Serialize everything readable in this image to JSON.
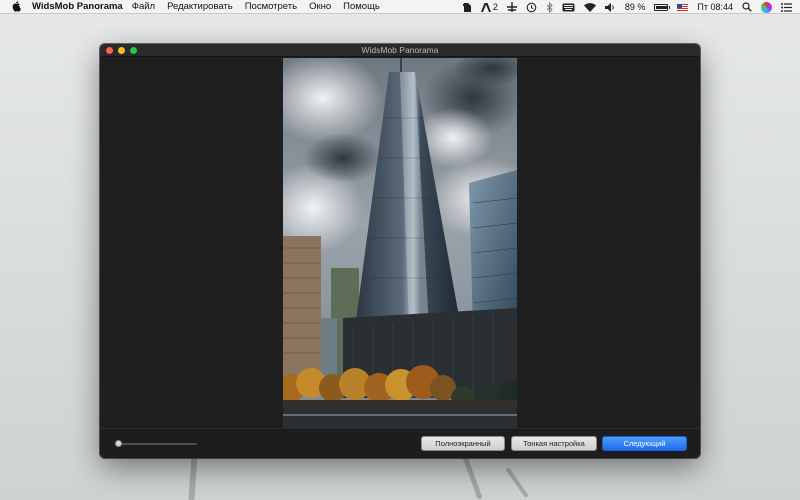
{
  "menubar": {
    "app_name": "WidsMob Panorama",
    "menus": [
      "Файл",
      "Редактировать",
      "Посмотреть",
      "Окно",
      "Помощь"
    ],
    "status": {
      "adobe_count": "2",
      "battery_percent": "89 %",
      "battery_level": 0.89,
      "clock": "Пт 08:44"
    },
    "icons": [
      "evernote-icon",
      "adobe-icon",
      "airplane-icon",
      "time-machine-icon",
      "bluetooth-icon",
      "keyboard-icon",
      "wifi-icon",
      "volume-icon",
      "battery-icon",
      "us-flag-icon",
      "search-icon",
      "siri-icon",
      "list-icon"
    ]
  },
  "window": {
    "title": "WidsMob Panorama",
    "traffic_colors": {
      "close": "#fc5f57",
      "minimize": "#fdbc2e",
      "maximize": "#28c840"
    }
  },
  "toolbar": {
    "fullscreen_label": "Полноэкранный",
    "finetune_label": "Тонкая настройка",
    "next_label": "Следующий",
    "zoom_slider_value": 0.0
  },
  "colors": {
    "accent": "#1d6ef0",
    "window_bg": "#1f1f1f"
  }
}
